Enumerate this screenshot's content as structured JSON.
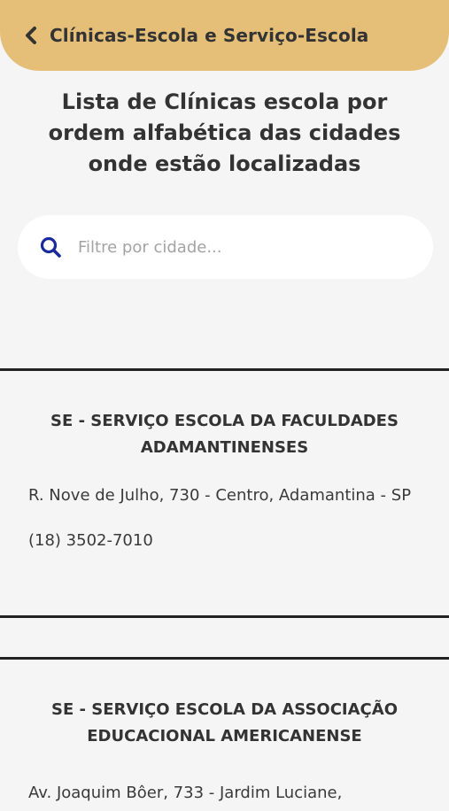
{
  "header": {
    "title": "Clínicas-Escola  e Serviço-Escola",
    "background_color": "#e5bf78",
    "back_icon": "chevron-left-icon"
  },
  "page": {
    "title": "Lista de Clínicas escola por ordem alfabética das cidades onde estão localizadas"
  },
  "search": {
    "placeholder": "Filtre por cidade...",
    "value": "",
    "icon": "search-icon",
    "icon_color": "#1a2a9a"
  },
  "clinics": [
    {
      "name": "SE - SERVIÇO ESCOLA DA FACULDADES ADAMANTINENSES",
      "address": "R. Nove de Julho, 730 - Centro, Adamantina - SP",
      "phone": "(18) 3502-7010"
    },
    {
      "name": "SE - SERVIÇO ESCOLA DA ASSOCIAÇÃO EDUCACIONAL AMERICANENSE",
      "address": "Av. Joaquim Bôer, 733 - Jardim Luciane,"
    }
  ]
}
